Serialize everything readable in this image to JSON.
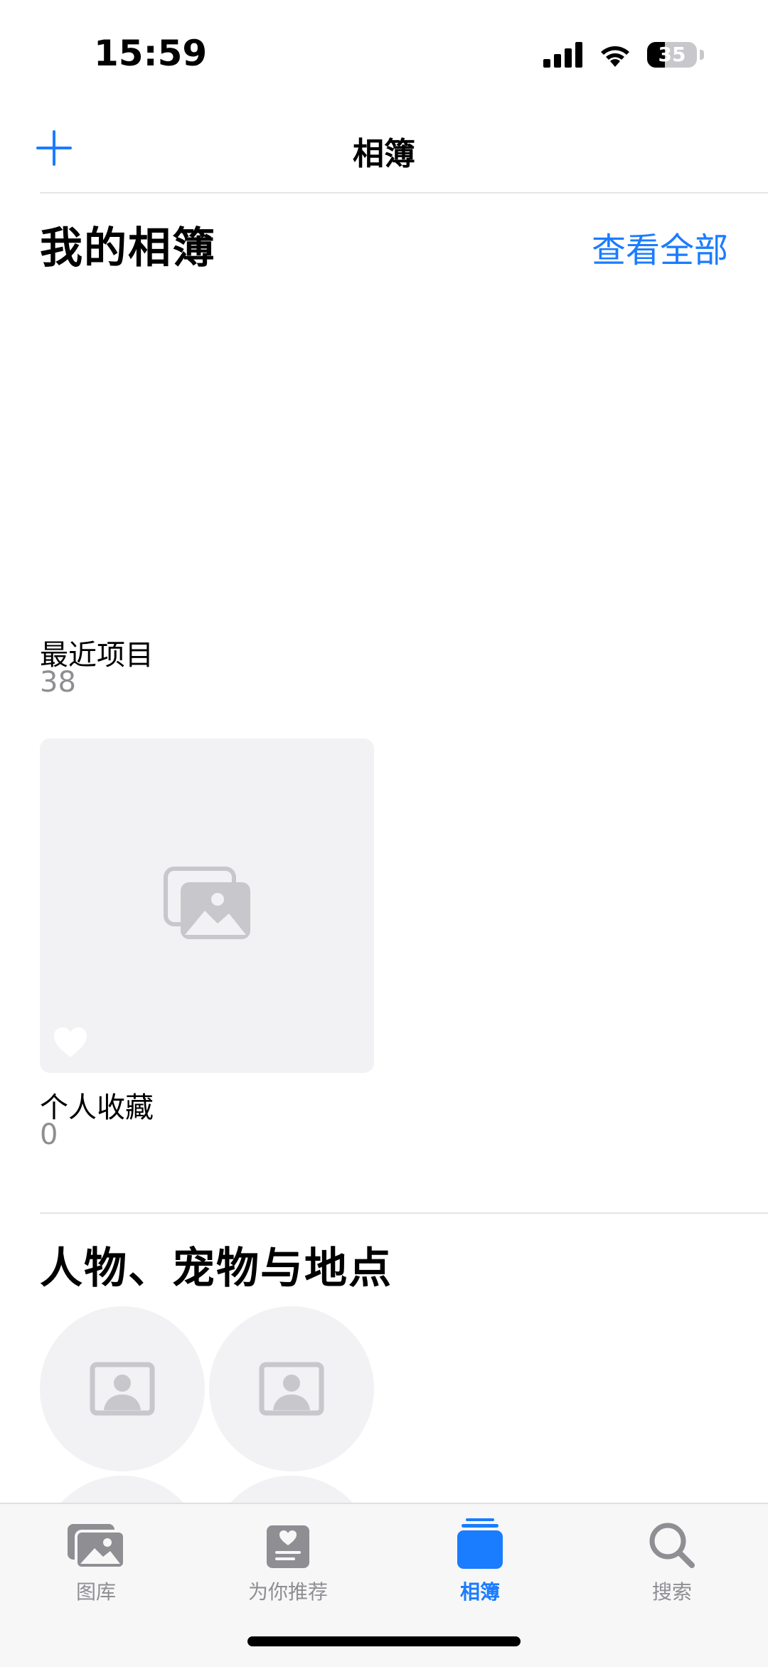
{
  "status_bar": {
    "time": "15:59",
    "battery_level": "35"
  },
  "nav": {
    "title": "相簿"
  },
  "my_albums": {
    "title": "我的相簿",
    "see_all": "查看全部",
    "albums": [
      {
        "name": "最近项目",
        "count": "38"
      },
      {
        "name": "个人收藏",
        "count": "0"
      }
    ]
  },
  "people_places": {
    "title": "人物、宠物与地点"
  },
  "tab_bar": {
    "tabs": [
      {
        "label": "图库",
        "icon": "photo-library-icon"
      },
      {
        "label": "为你推荐",
        "icon": "for-you-icon"
      },
      {
        "label": "相簿",
        "icon": "albums-icon"
      },
      {
        "label": "搜索",
        "icon": "search-icon"
      }
    ],
    "active_index": 2
  },
  "colors": {
    "accent": "#1a7cff",
    "secondary_text": "#8e8e93",
    "placeholder_bg": "#f2f2f4",
    "placeholder_icon": "#c7c7cc"
  }
}
